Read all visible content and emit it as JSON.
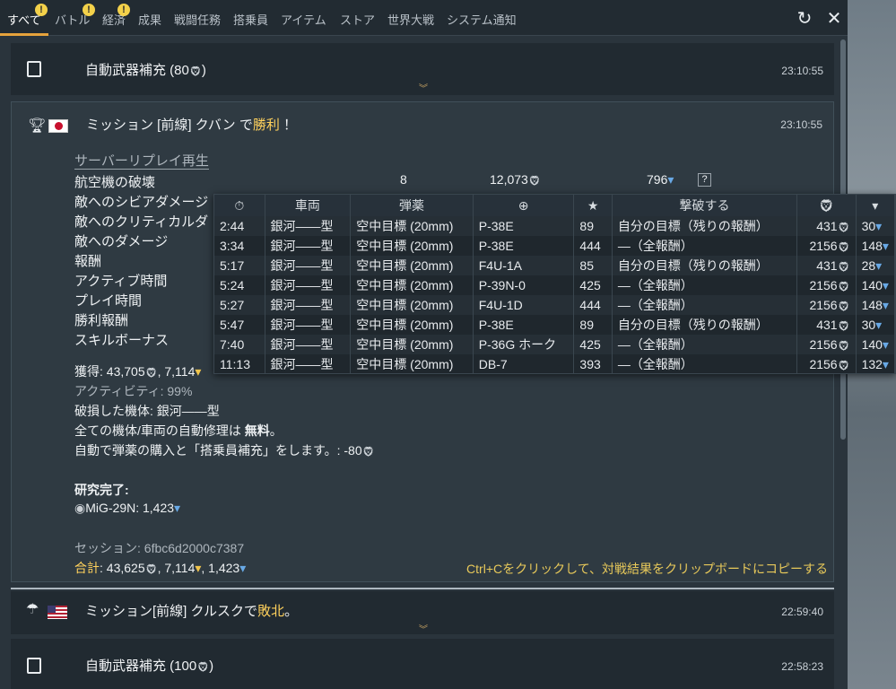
{
  "tabs": [
    {
      "label": "すべて",
      "active": true,
      "badge": ""
    },
    {
      "label": "バトル",
      "badge": "!"
    },
    {
      "label": "経済",
      "badge": "!"
    },
    {
      "label": "成果",
      "badge": "!"
    },
    {
      "label": "戦闘任務",
      "badge": ""
    },
    {
      "label": "搭乗員",
      "badge": ""
    },
    {
      "label": "アイテム",
      "badge": ""
    },
    {
      "label": "ストア",
      "badge": ""
    },
    {
      "label": "世界大戦",
      "badge": ""
    },
    {
      "label": "システム通知",
      "badge": ""
    }
  ],
  "top_buttons": {
    "refresh": "↻",
    "close": "✕"
  },
  "feed": {
    "row1": {
      "title_prefix": "自動武器補充 (80",
      "title_suffix": ")",
      "time": "23:10:55"
    },
    "expanded": {
      "title_a": "ミッション [前線] クバン で",
      "title_result": "勝利",
      "title_end": " ！",
      "time": "23:10:55",
      "replay_link": "サーバーリプレイ再生",
      "stat_labels": [
        "航空機の破壊",
        "敵へのシビアダメージ",
        "敵へのクリティカルダ",
        "敵へのダメージ",
        "報酬",
        "アクティブ時間",
        "プレイ時間",
        "勝利報酬",
        "スキルボーナス"
      ],
      "stat_row1": {
        "count": "8",
        "silver": "12,073",
        "rp": "796"
      },
      "help_icon": "?",
      "earned": "獲得: 43,705",
      "earned_gold": ", 7,114",
      "activity": "アクティビティ: 99%",
      "damaged": "破損した機体: 銀河――型",
      "repair_prefix": "全ての機体/車両の自動修理は ",
      "repair_value": "無料",
      "repair_suffix": "。",
      "ammo_purchase": "自動で弾薬の購入と「搭乗員補充」をします。: -80",
      "research_heading": "研究完了:",
      "research_item": "MiG-29N: 1,423",
      "session": "セッション: 6fbc6d2000c7387",
      "total_label": "合計",
      "total_value": ": 43,625",
      "total_gold": ", 7,114",
      "total_rp": ", 1,423",
      "copy_hint_key": "Ctrl+C",
      "copy_hint_text": "をクリックして、対戦結果をクリップボードにコピーする"
    },
    "row3": {
      "title_a": "ミッション[前線] クルスクで",
      "title_result": "敗北",
      "title_end": "。",
      "time": "22:59:40"
    },
    "row4": {
      "title_prefix": "自動武器補充 (100",
      "title_suffix": ")",
      "time": "22:58:23"
    }
  },
  "table": {
    "headers": [
      "⏱",
      "車両",
      "弾薬",
      "⊕",
      "★",
      "撃破する",
      "",
      ""
    ],
    "rows": [
      {
        "time": "2:44",
        "vehicle": "銀河――型",
        "ammo": "空中目標 (20mm)",
        "target": "P-38E",
        "score": "89",
        "reward": "自分の目標（残りの報酬）",
        "silver": "431",
        "rp": "30"
      },
      {
        "time": "3:34",
        "vehicle": "銀河――型",
        "ammo": "空中目標 (20mm)",
        "target": "P-38E",
        "score": "444",
        "reward": "―（全報酬）",
        "silver": "2156",
        "rp": "148"
      },
      {
        "time": "5:17",
        "vehicle": "銀河――型",
        "ammo": "空中目標 (20mm)",
        "target": "F4U-1A",
        "score": "85",
        "reward": "自分の目標（残りの報酬）",
        "silver": "431",
        "rp": "28"
      },
      {
        "time": "5:24",
        "vehicle": "銀河――型",
        "ammo": "空中目標 (20mm)",
        "target": "P-39N-0",
        "score": "425",
        "reward": "―（全報酬）",
        "silver": "2156",
        "rp": "140"
      },
      {
        "time": "5:27",
        "vehicle": "銀河――型",
        "ammo": "空中目標 (20mm)",
        "target": "F4U-1D",
        "score": "444",
        "reward": "―（全報酬）",
        "silver": "2156",
        "rp": "148"
      },
      {
        "time": "5:47",
        "vehicle": "銀河――型",
        "ammo": "空中目標 (20mm)",
        "target": "P-38E",
        "score": "89",
        "reward": "自分の目標（残りの報酬）",
        "silver": "431",
        "rp": "30"
      },
      {
        "time": "7:40",
        "vehicle": "銀河――型",
        "ammo": "空中目標 (20mm)",
        "target": "P-36G ホーク",
        "score": "425",
        "reward": "―（全報酬）",
        "silver": "2156",
        "rp": "140"
      },
      {
        "time": "11:13",
        "vehicle": "銀河――型",
        "ammo": "空中目標 (20mm)",
        "target": "DB-7",
        "score": "393",
        "reward": "―（全報酬）",
        "silver": "2156",
        "rp": "132"
      }
    ]
  },
  "colors": {
    "accent": "#e6a23c",
    "gold": "#f0c44c",
    "rp_blue": "#69a9e6"
  },
  "icons": {
    "silver": "silver-lion-icon",
    "gold": "golden-eagle-icon",
    "rp": "research-point-icon"
  }
}
